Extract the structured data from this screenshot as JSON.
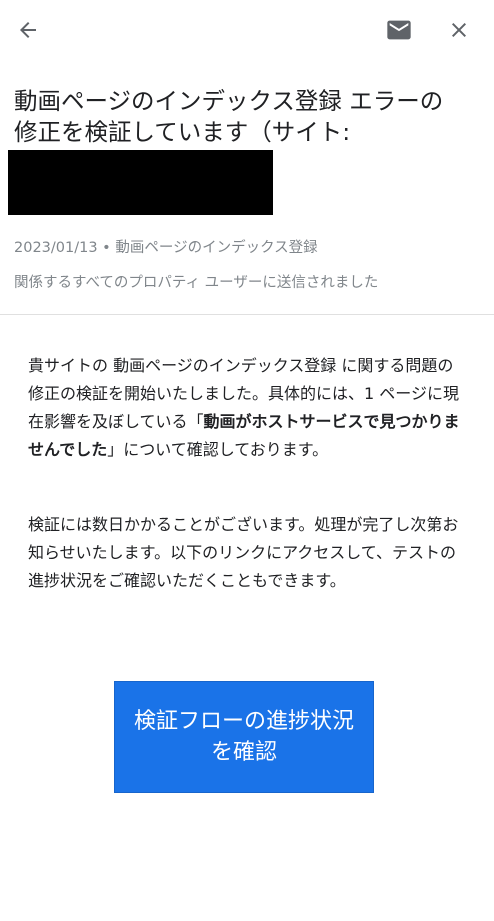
{
  "header": {
    "back_icon": "arrow-left-icon",
    "mail_icon": "envelope-icon",
    "close_icon": "close-icon"
  },
  "email": {
    "title": "動画ページのインデックス登録 エラーの修正を検証しています（サイト:",
    "meta_date": "2023/01/13",
    "meta_separator": " • ",
    "meta_category": "動画ページのインデックス登録",
    "meta_recipients": "関係するすべてのプロパティ ユーザーに送信されました"
  },
  "body": {
    "p1_a": "貴サイトの 動画ページのインデックス登録 に関する問題の修正の検証を開始いたしました。具体的には、1 ページに現在影響を及ぼしている「",
    "p1_bold": "動画がホストサービスで見つかりませんでした",
    "p1_b": "」について確認しております。",
    "p2": "検証には数日かかることがございます。処理が完了し次第お知らせいたします。以下のリンクにアクセスして、テストの進捗状況をご確認いただくこともできます。"
  },
  "cta": {
    "label": "検証フローの進捗状況を確認"
  },
  "colors": {
    "icon": "#5f6368",
    "meta_text": "#80868b",
    "button": "#1a73e8",
    "divider": "#e0e0e0"
  }
}
